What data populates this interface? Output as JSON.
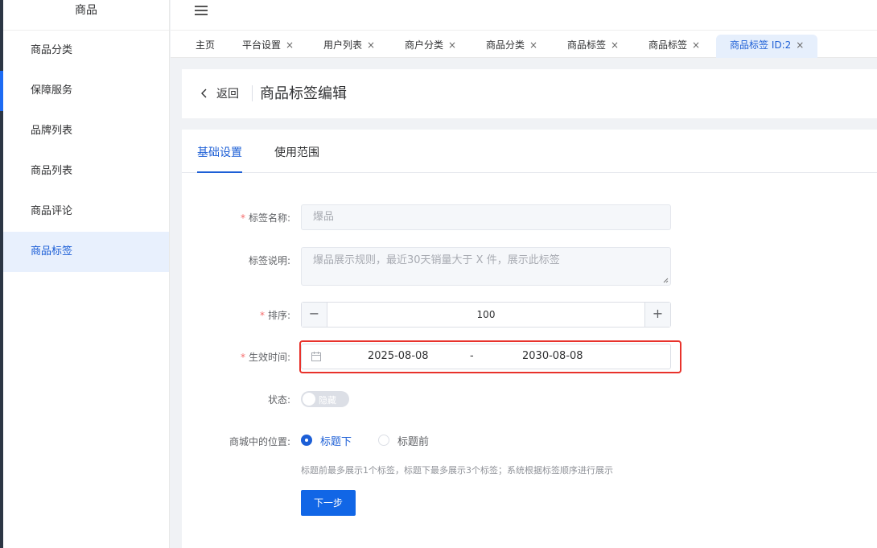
{
  "sidebar": {
    "title": "商品",
    "items": [
      {
        "label": "商品分类"
      },
      {
        "label": "保障服务"
      },
      {
        "label": "品牌列表"
      },
      {
        "label": "商品列表"
      },
      {
        "label": "商品评论"
      },
      {
        "label": "商品标签"
      }
    ]
  },
  "tabs": [
    {
      "label": "主页"
    },
    {
      "label": "平台设置"
    },
    {
      "label": "用户列表"
    },
    {
      "label": "商户分类"
    },
    {
      "label": "商品分类"
    },
    {
      "label": "商品标签"
    },
    {
      "label": "商品标签"
    },
    {
      "label": "商品标签 ID:2"
    }
  ],
  "tab_close": "×",
  "header": {
    "back_label": "返回",
    "title": "商品标签编辑"
  },
  "sub_tabs": [
    {
      "label": "基础设置"
    },
    {
      "label": "使用范围"
    }
  ],
  "form": {
    "name_label": "标签名称:",
    "name_value": "爆品",
    "desc_label": "标签说明:",
    "desc_value": "爆品展示规则，最近30天销量大于 X 件，展示此标签",
    "sort_label": "排序:",
    "sort_value": "100",
    "minus": "−",
    "plus": "+",
    "time_label": "生效时间:",
    "start_date": "2025-08-08",
    "date_sep": "-",
    "end_date": "2030-08-08",
    "status_label": "状态:",
    "status_text": "隐藏",
    "position_label": "商城中的位置:",
    "position_options": [
      {
        "label": "标题下",
        "checked": true
      },
      {
        "label": "标题前",
        "checked": false
      }
    ],
    "hint": "标题前最多展示1个标签，标题下最多展示3个标签；系统根据标签顺序进行展示",
    "next_button": "下一步"
  },
  "colors": {
    "accent": "#1d5fd6",
    "button": "#1166e6",
    "highlight": "#e8322b",
    "required": "#f56c6c"
  }
}
